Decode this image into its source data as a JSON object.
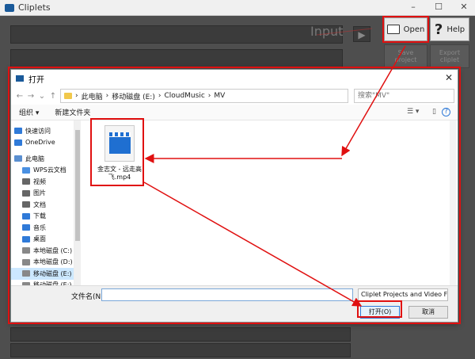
{
  "app": {
    "title": "Cliplets",
    "window_controls": [
      "–",
      "☐",
      "✕"
    ],
    "input_ghost": "Input",
    "open_label": "Open",
    "help_label": "Help",
    "save_label": "Save project",
    "export_label": "Export cliplet"
  },
  "dialog": {
    "title": "打开",
    "close": "✕",
    "breadcrumb": [
      "此电脑",
      "移动磁盘 (E:)",
      "CloudMusic",
      "MV"
    ],
    "search_placeholder": "搜索\"MV\"",
    "organize": "组织 ▾",
    "new_folder": "新建文件夹",
    "view_controls": [
      "☰ ▾",
      "▯",
      "?"
    ],
    "nav_items": [
      {
        "label": "快速访问",
        "color": "#2f7ad8"
      },
      {
        "label": "OneDrive",
        "color": "#2f7ad8"
      },
      {
        "label": "此电脑",
        "color": "#5a8fd0"
      },
      {
        "label": "WPS云文档",
        "color": "#4a90e2"
      },
      {
        "label": "视频",
        "color": "#666"
      },
      {
        "label": "图片",
        "color": "#666"
      },
      {
        "label": "文档",
        "color": "#666"
      },
      {
        "label": "下载",
        "color": "#2f7ad8"
      },
      {
        "label": "音乐",
        "color": "#2f7ad8"
      },
      {
        "label": "桌面",
        "color": "#2f7ad8"
      },
      {
        "label": "本地磁盘 (C:)",
        "color": "#888"
      },
      {
        "label": "本地磁盘 (D:)",
        "color": "#888"
      },
      {
        "label": "移动磁盘 (E:)",
        "color": "#888"
      },
      {
        "label": "移动磁盘 (E:)",
        "color": "#888"
      }
    ],
    "file_name": "金志文 - 远走高飞.mp4",
    "filename_label": "文件名(N):",
    "filename_value": "",
    "filter": "Cliplet Projects and Video Fi",
    "open_button": "打开(O)",
    "cancel_button": "取消"
  }
}
